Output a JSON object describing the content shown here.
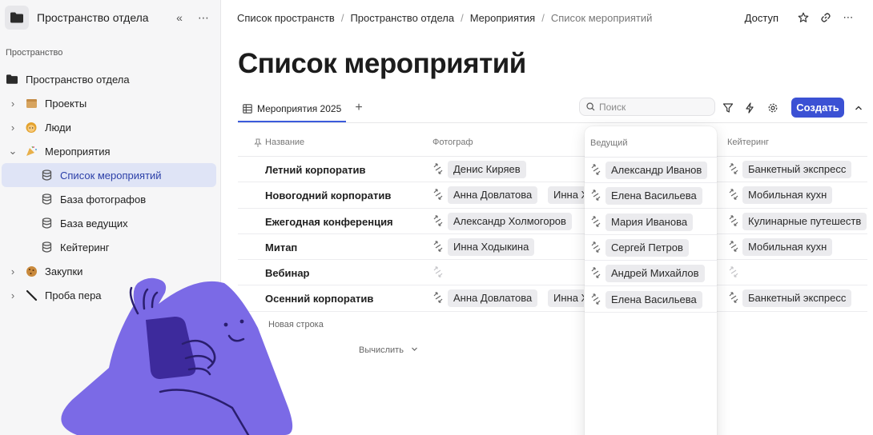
{
  "sidebar": {
    "title": "Пространство отдела",
    "section_label": "Пространство",
    "items": [
      {
        "label": "Пространство отдела",
        "icon": "folder-icon",
        "expand": "none"
      },
      {
        "label": "Проекты",
        "icon": "box-emoji",
        "emoji": "🗃",
        "expand": "collapsed"
      },
      {
        "label": "Люди",
        "icon": "person-emoji",
        "emoji": "👩",
        "expand": "collapsed"
      },
      {
        "label": "Мероприятия",
        "icon": "party-emoji",
        "emoji": "🎉",
        "expand": "expanded"
      },
      {
        "label": "Список мероприятий",
        "icon": "database-icon",
        "expand": "child",
        "active": true
      },
      {
        "label": "База фотографов",
        "icon": "database-icon",
        "expand": "child"
      },
      {
        "label": "База ведущих",
        "icon": "database-icon",
        "expand": "child"
      },
      {
        "label": "Кейтеринг",
        "icon": "database-icon",
        "expand": "child"
      },
      {
        "label": "Закупки",
        "icon": "cookie-emoji",
        "emoji": "🍪",
        "expand": "collapsed"
      },
      {
        "label": "Проба пера",
        "icon": "pen-emoji",
        "emoji": "✒️",
        "expand": "collapsed"
      }
    ]
  },
  "breadcrumb": [
    "Список пространств",
    "Пространство отдела",
    "Мероприятия",
    "Список мероприятий"
  ],
  "topbar": {
    "access_label": "Доступ"
  },
  "page_title": "Список мероприятий",
  "tabs": [
    {
      "label": "Мероприятия 2025",
      "active": true
    }
  ],
  "search": {
    "placeholder": "Поиск",
    "value": ""
  },
  "create_label": "Создать",
  "columns": {
    "name": "Название",
    "photographer": "Фотограф",
    "host": "Ведущий",
    "catering": "Кейтеринг"
  },
  "rows": [
    {
      "name": "Летний корпоратив",
      "photographers": [
        "Денис Киряев"
      ],
      "host": "Александр Иванов",
      "catering": "Банкетный экспресс"
    },
    {
      "name": "Новогодний корпоратив",
      "photographers": [
        "Анна Довлатова",
        "Инна Хо"
      ],
      "host": "Елена Васильева",
      "catering": "Мобильная кухн"
    },
    {
      "name": "Ежегодная конференция",
      "photographers": [
        "Александр Холмогоров",
        "И"
      ],
      "host": "Мария Иванова",
      "catering": "Кулинарные путешеств"
    },
    {
      "name": "Митап",
      "photographers": [
        "Инна Ходыкина"
      ],
      "host": "Сергей Петров",
      "catering": "Мобильная кухн"
    },
    {
      "name": "Вебинар",
      "photographers": [],
      "host": "Андрей Михайлов",
      "catering": ""
    },
    {
      "name": "Осенний корпоратив",
      "photographers": [
        "Анна Довлатова",
        "Инна Хо"
      ],
      "host": "Елена Васильева",
      "catering": "Банкетный экспресс"
    }
  ],
  "new_row_label": "Новая строка",
  "calc_label": "Вычислить",
  "colors": {
    "accent": "#3b51d4",
    "active_bg": "#dfe4f6",
    "mascot": "#7b6ae6"
  }
}
